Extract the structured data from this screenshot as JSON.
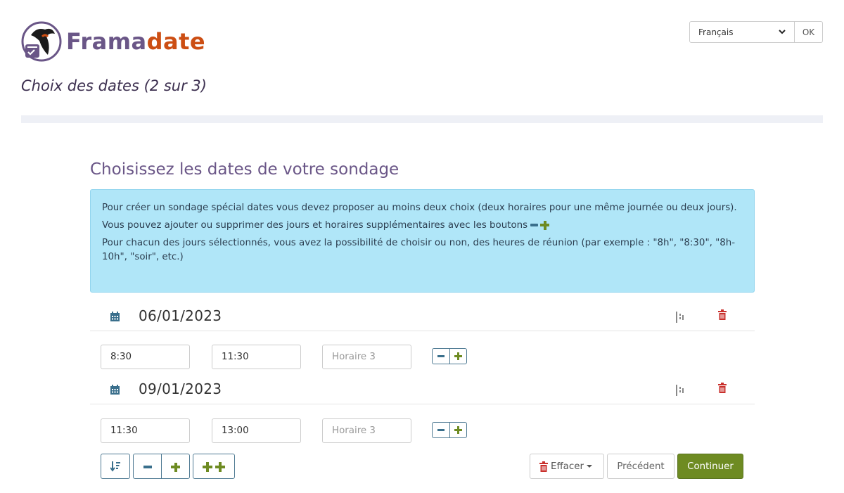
{
  "brand": {
    "part1": "Frama",
    "part2": "date",
    "color1": "#6a5687",
    "color2": "#cc4e13"
  },
  "language": {
    "selected": "Français",
    "ok_label": "OK"
  },
  "page": {
    "subtitle": "Choix des dates (2 sur 3)"
  },
  "section": {
    "title": "Choisissez les dates de votre sondage"
  },
  "info": {
    "line1": "Pour créer un sondage spécial dates vous devez proposer au moins deux choix (deux horaires pour une même journée ou deux jours).",
    "line2": "Vous pouvez ajouter ou supprimer des jours et horaires supplémentaires avec les boutons",
    "line3": "Pour chacun des jours sélectionnés, vous avez la possibilité de choisir ou non, des heures de réunion (par exemple : \"8h\", \"8:30\", \"8h-10h\", \"soir\", etc.)"
  },
  "days": [
    {
      "date": "06/01/2023",
      "times": [
        "8:30",
        "11:30"
      ],
      "placeholder": "Horaire 3"
    },
    {
      "date": "09/01/2023",
      "times": [
        "11:30",
        "13:00"
      ],
      "placeholder": "Horaire 3"
    }
  ],
  "actions": {
    "clear_label": "Effacer",
    "prev_label": "Précédent",
    "next_label": "Continuer"
  },
  "colors": {
    "accent": "#6a5687",
    "info_bg": "#b0e6f8",
    "success": "#6e8b22",
    "danger": "#c9302c",
    "primary_outline": "#4f7a93"
  },
  "icons": [
    "calendar-icon",
    "copy-hours-icon",
    "trash-icon",
    "sort-icon",
    "minus-icon",
    "plus-icon",
    "double-plus-icon",
    "chevron-down-icon"
  ]
}
